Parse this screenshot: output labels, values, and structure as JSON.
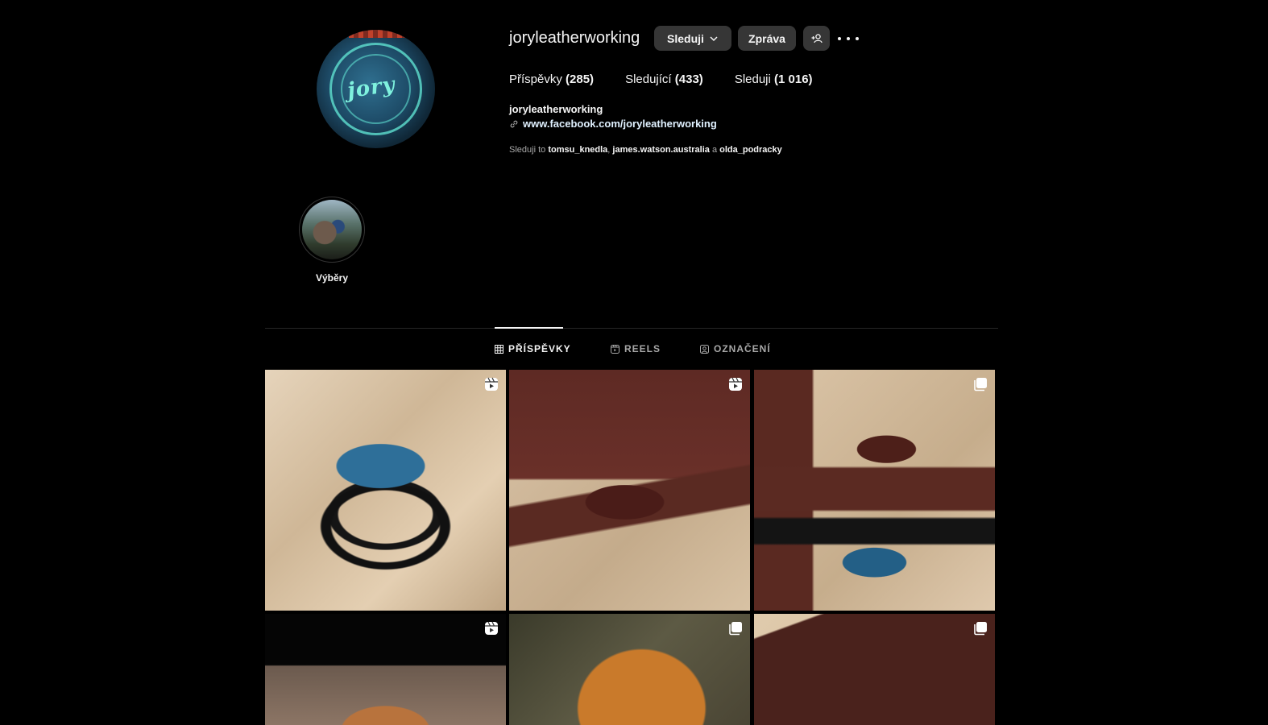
{
  "profile": {
    "username": "joryleatherworking",
    "follow_button": "Sleduji",
    "message_button": "Zpráva",
    "stats": {
      "posts_label": "Příspěvky",
      "posts_count": "(285)",
      "followers_label": "Sledující",
      "followers_count": "(433)",
      "following_label": "Sleduji",
      "following_count": "(1 016)"
    },
    "display_name": "joryleatherworking",
    "link": "www.facebook.com/joryleatherworking",
    "followed_by": {
      "prefix": "Sleduji to",
      "user1": "tomsu_knedla",
      "sep1": ",",
      "user2": "james.watson.australia",
      "conj": "a",
      "user3": "olda_podracky"
    },
    "avatar_logo_text": "jory"
  },
  "highlights": [
    {
      "label": "Výběry"
    }
  ],
  "tabs": [
    {
      "label": "PŘÍSPĚVKY",
      "icon": "grid-icon",
      "active": true
    },
    {
      "label": "REELS",
      "icon": "reels-icon",
      "active": false
    },
    {
      "label": "OZNAČENÍ",
      "icon": "tagged-icon",
      "active": false
    }
  ],
  "posts": [
    {
      "type": "reel",
      "badge_icon": "reel-icon"
    },
    {
      "type": "reel",
      "badge_icon": "reel-icon"
    },
    {
      "type": "carousel",
      "badge_icon": "carousel-icon"
    },
    {
      "type": "reel",
      "badge_icon": "reel-icon"
    },
    {
      "type": "carousel",
      "badge_icon": "carousel-icon"
    },
    {
      "type": "carousel",
      "badge_icon": "carousel-icon"
    }
  ],
  "colors": {
    "background": "#000000",
    "button_bg": "#363636",
    "text_primary": "#f5f5f5",
    "text_secondary": "#a8a8a8",
    "divider": "#262626"
  }
}
